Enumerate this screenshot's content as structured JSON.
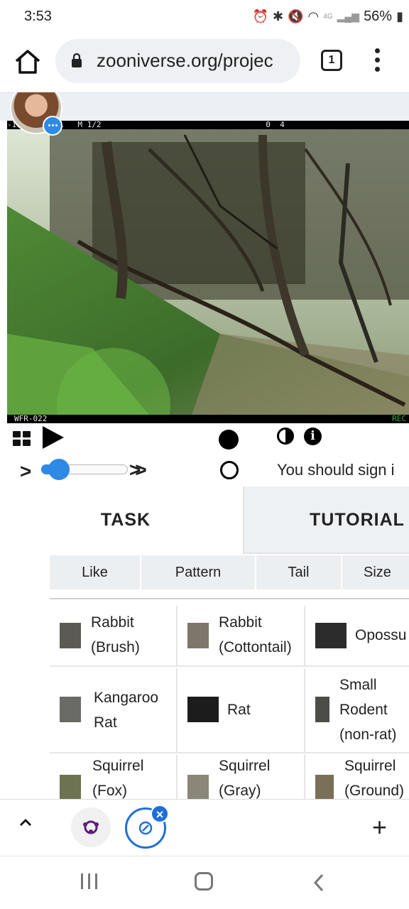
{
  "status_bar": {
    "time": "3:53",
    "network": "4G",
    "battery": "56%"
  },
  "browser": {
    "url": "zooniverse.org/projec",
    "tab_count": "1"
  },
  "camera": {
    "header_text": "-16 09:40:01   M 1/2                                   0  4",
    "footer_text": "WFR-022",
    "logo_text": "REC"
  },
  "controls": {
    "sign_in_notice": "You should sign i"
  },
  "tabs": {
    "task": "TASK",
    "tutorial": "TUTORIAL"
  },
  "filters": [
    "Like",
    "Pattern",
    "Tail",
    "Size"
  ],
  "species": [
    {
      "line1": "Rabbit",
      "line2": "(Brush)",
      "line3": ""
    },
    {
      "line1": "Rabbit",
      "line2": "(Cottontail)",
      "line3": ""
    },
    {
      "line1": "Opossu",
      "line2": "",
      "line3": ""
    },
    {
      "line1": "Kangaroo",
      "line2": "Rat",
      "line3": ""
    },
    {
      "line1": "Rat",
      "line2": "",
      "line3": ""
    },
    {
      "line1": "Small",
      "line2": "Rodent",
      "line3": "(non-rat)"
    },
    {
      "line1": "Squirrel",
      "line2": "(Fox)",
      "line3": ""
    },
    {
      "line1": "Squirrel",
      "line2": "(Gray)",
      "line3": ""
    },
    {
      "line1": "Squirrel",
      "line2": "(Ground)",
      "line3": ""
    }
  ],
  "colors": {
    "accent": "#2d8ae5",
    "tab_blue": "#1e6fd9",
    "zooniverse_purple": "#5a1f7a"
  }
}
